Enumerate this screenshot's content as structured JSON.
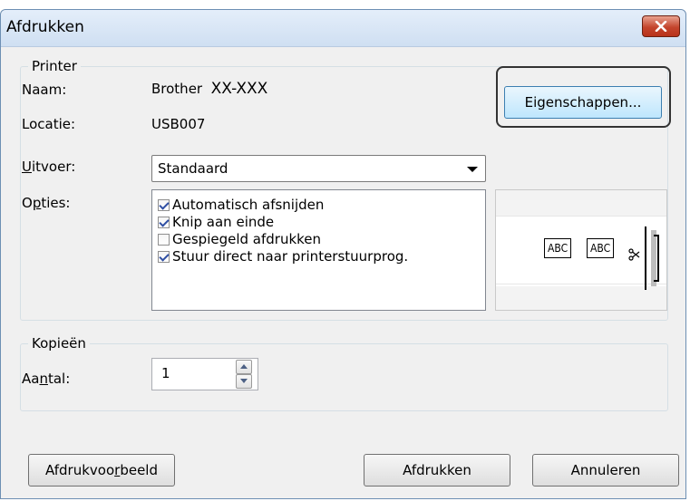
{
  "window": {
    "title": "Afdrukken",
    "close_icon": "close-icon"
  },
  "printer_group": {
    "legend": "Printer",
    "name_label": "Naam:",
    "name_value_prefix": "Brother",
    "name_value_model": "XX-XXX",
    "location_label": "Locatie:",
    "location_value": "USB007",
    "properties_button": "Eigenschappen...",
    "output_label_u": "U",
    "output_label_rest": "itvoer:",
    "output_value": "Standaard",
    "options_label_pre": "O",
    "options_label_u": "p",
    "options_label_rest": "ties:",
    "options": [
      {
        "label": "Automatisch afsnijden",
        "checked": true
      },
      {
        "label": "Knip aan einde",
        "checked": true
      },
      {
        "label": "Gespiegeld afdrukken",
        "checked": false
      },
      {
        "label": "Stuur direct naar printerstuurprog.",
        "checked": true
      }
    ],
    "preview": {
      "label1": "ABC",
      "label2": "ABC",
      "cut_icon": "scissors-icon"
    }
  },
  "copies_group": {
    "legend": "Kopieën",
    "count_label_pre": "Aa",
    "count_label_u": "n",
    "count_label_rest": "tal:",
    "count_value": "1"
  },
  "buttons": {
    "preview_pre": "Afdrukvoo",
    "preview_u": "r",
    "preview_rest": "beeld",
    "print": "Afdrukken",
    "cancel": "Annuleren"
  },
  "colors": {
    "titlebar": "#cfdff2",
    "close_button": "#c4452d",
    "dialog_bg": "#f0f0f0",
    "focus_button": "#bee6fd"
  }
}
